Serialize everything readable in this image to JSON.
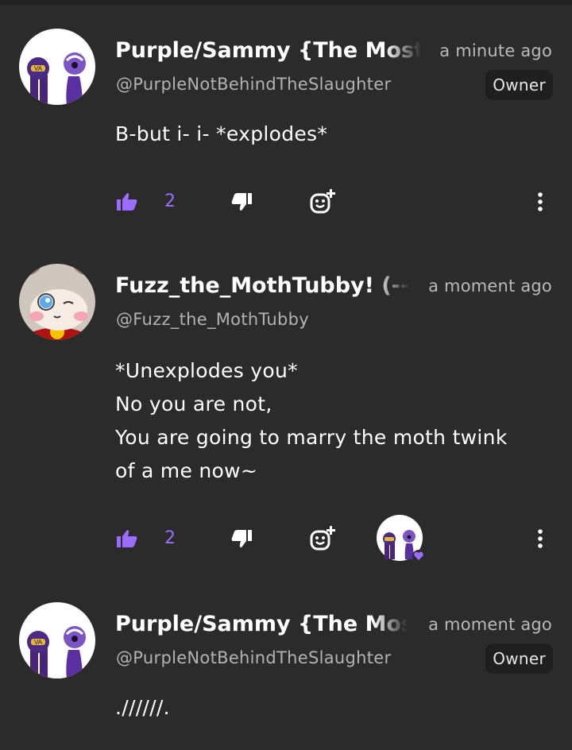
{
  "colors": {
    "background": "#2b2b2b",
    "accent": "#9c6cff",
    "muted_text": "#b9b9b9",
    "badge_bg": "#1f1f1f"
  },
  "comments": [
    {
      "author_name": "Purple/Sammy {The Most I",
      "timestamp": "a minute ago",
      "handle": "@PurpleNotBehindTheSlaughter",
      "badge": "Owner",
      "lines": [
        "B-but i- i- *explodes*"
      ],
      "like_count": "2",
      "avatar": "purple-guys-avatar"
    },
    {
      "author_name": "Fuzz_the_MothTubby! (--★",
      "timestamp": "a moment ago",
      "handle": "@Fuzz_the_MothTubby",
      "lines": [
        "*Unexplodes you*",
        "No you are not,",
        "You are going to marry the moth twink",
        "of a me now~"
      ],
      "like_count": "2",
      "avatar": "moth-avatar",
      "hearted_by": "purple-guys-avatar"
    },
    {
      "author_name": "Purple/Sammy {The Most",
      "timestamp": "a moment ago",
      "handle": "@PurpleNotBehindTheSlaughter",
      "badge": "Owner",
      "lines": [
        ".//////."
      ],
      "avatar": "purple-guys-avatar"
    }
  ],
  "icons": {
    "like": "thumbs-up-icon",
    "dislike": "thumbs-down-icon",
    "react": "add-reaction-icon",
    "more": "more-vertical-icon",
    "heart": "heart-icon"
  }
}
